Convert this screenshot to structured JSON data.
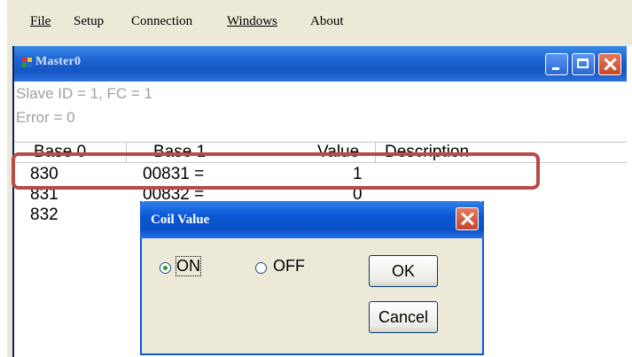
{
  "menu": {
    "file": "File",
    "setup": "Setup",
    "connection": "Connection",
    "windows": "Windows",
    "about": "About"
  },
  "child_window": {
    "title": "Master0",
    "status_line_1": "Slave ID = 1, FC = 1",
    "status_line_2": "Error = 0"
  },
  "grid": {
    "columns": [
      "Base 0",
      "Base 1",
      "Value",
      "Description"
    ],
    "rows": [
      {
        "base0": "830",
        "base1": "00831  =",
        "value": "1",
        "description": ""
      },
      {
        "base0": "831",
        "base1": "00832  =",
        "value": "0",
        "description": ""
      },
      {
        "base0": "832",
        "base1": "",
        "value": "",
        "description": ""
      }
    ]
  },
  "dialog": {
    "title": "Coil Value",
    "option_on": "ON",
    "option_off": "OFF",
    "selected": "ON",
    "ok_label": "OK",
    "cancel_label": "Cancel"
  },
  "colors": {
    "highlight_border": "#b84a48",
    "titlebar_blue": "#1655c4",
    "dialog_face": "#ece9d8"
  },
  "icons": [
    "window-app-icon",
    "minimize-icon",
    "maximize-icon",
    "close-icon",
    "dialog-close-icon"
  ]
}
